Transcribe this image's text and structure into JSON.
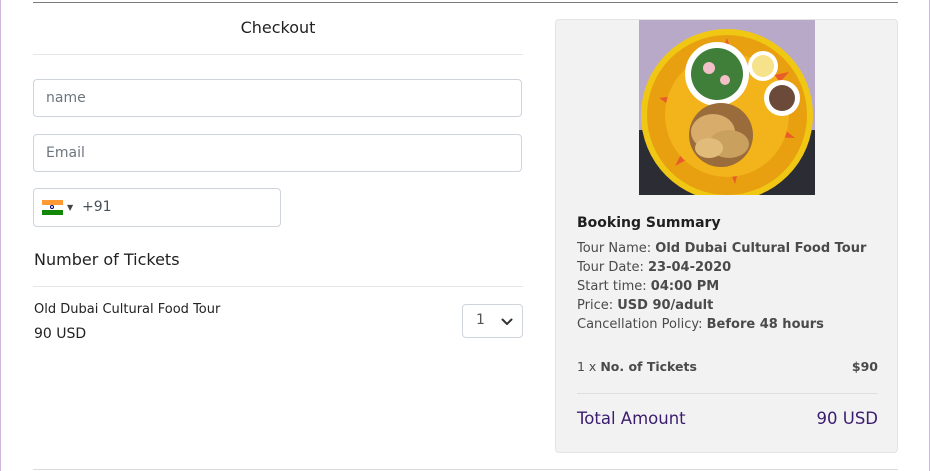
{
  "checkout": {
    "title": "Checkout",
    "name_placeholder": "name",
    "email_placeholder": "Email",
    "phone": {
      "country_flag": "india-flag-icon",
      "dial_code": "+91"
    },
    "tickets_heading": "Number of Tickets",
    "ticket": {
      "name": "Old Dubai Cultural Food Tour",
      "price": "90 USD",
      "quantity": "1"
    }
  },
  "summary": {
    "image": "food-platter-photo",
    "title": "Booking Summary",
    "rows": [
      {
        "label": "Tour Name: ",
        "value": "Old Dubai Cultural Food Tour"
      },
      {
        "label": "Tour Date: ",
        "value": "23-04-2020"
      },
      {
        "label": "Start time: ",
        "value": "04:00 PM"
      },
      {
        "label": "Price: ",
        "value": "USD 90/adult"
      },
      {
        "label": "Cancellation Policy: ",
        "value": "Before 48 hours"
      }
    ],
    "tickets_prefix": "1 x ",
    "tickets_label": "No. of Tickets",
    "tickets_amount": "$90",
    "total_label": "Total Amount",
    "total_value": "90 USD"
  },
  "colors": {
    "accent": "#3a1d6e",
    "panel": "#f2f2f2"
  }
}
